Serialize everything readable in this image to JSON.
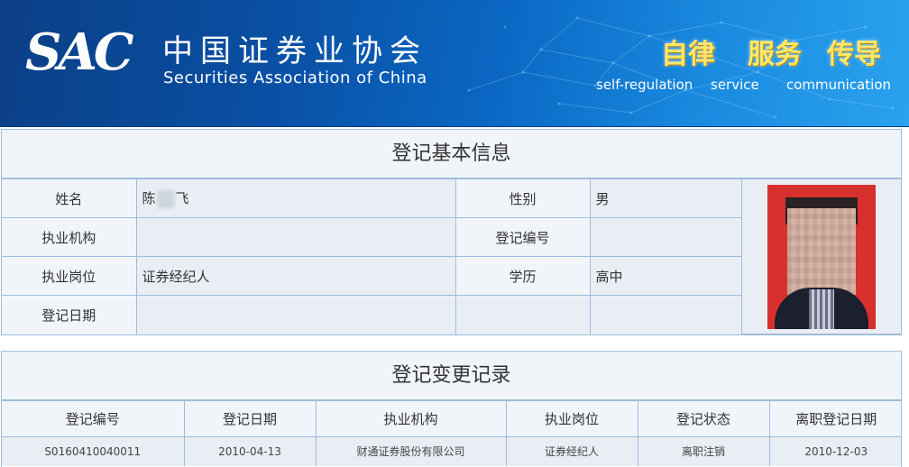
{
  "banner": {
    "logo_text": "SAC",
    "org_name_cn": "中国证券业协会",
    "org_name_en": "Securities Association of China",
    "slogans": [
      {
        "cn": "自律",
        "en": "self-regulation"
      },
      {
        "cn": "服务",
        "en": "service"
      },
      {
        "cn": "传导",
        "en": "communication"
      }
    ],
    "slogan_color": "#ffe76a"
  },
  "basic_info": {
    "title": "登记基本信息",
    "name_label": "姓名",
    "name_value_prefix": "陈",
    "name_value_suffix": "飞",
    "gender_label": "性别",
    "gender_value": "男",
    "institution_label": "执业机构",
    "institution_value": "",
    "reg_no_label": "登记编号",
    "reg_no_value": "",
    "position_label": "执业岗位",
    "position_value": "证券经纪人",
    "education_label": "学历",
    "education_value": "高中",
    "reg_date_label": "登记日期",
    "reg_date_value": ""
  },
  "change_records": {
    "title": "登记变更记录",
    "columns": [
      "登记编号",
      "登记日期",
      "执业机构",
      "执业岗位",
      "登记状态",
      "离职登记日期"
    ],
    "rows": [
      [
        "S0160410040011",
        "2010-04-13",
        "财通证券股份有限公司",
        "证券经纪人",
        "离职注销",
        "2010-12-03"
      ]
    ]
  },
  "colors": {
    "border": "#9dbcdc",
    "label_bg": "#f1f5fa",
    "value_bg": "#e9eef5",
    "banner_dark": "#0b3f86",
    "banner_light": "#2aa2ee"
  }
}
